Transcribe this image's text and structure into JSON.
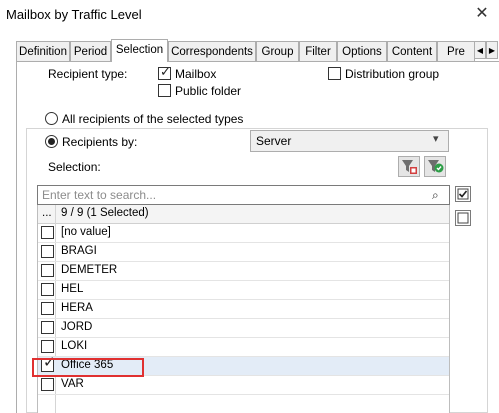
{
  "window": {
    "title": "Mailbox by Traffic Level"
  },
  "tabs": [
    "Definition",
    "Period",
    "Selection",
    "Correspondents",
    "Group",
    "Filter",
    "Options",
    "Content",
    "Pre"
  ],
  "active_tab": "Selection",
  "recipient_type": {
    "label": "Recipient type:",
    "mailbox": {
      "label": "Mailbox",
      "checked": true
    },
    "public_folder": {
      "label": "Public folder",
      "checked": false
    },
    "distribution_group": {
      "label": "Distribution group",
      "checked": false
    }
  },
  "scope": {
    "all_label": "All recipients of the selected types",
    "by_label": "Recipients by:",
    "selected": "by",
    "recipients_by_value": "Server"
  },
  "selection": {
    "label": "Selection:",
    "search_placeholder": "Enter text to search...",
    "header_dots": "...",
    "header_count": "9 / 9 (1 Selected)",
    "rows": [
      {
        "name": "[no value]",
        "checked": false
      },
      {
        "name": "BRAGI",
        "checked": false
      },
      {
        "name": "DEMETER",
        "checked": false
      },
      {
        "name": "HEL",
        "checked": false
      },
      {
        "name": "HERA",
        "checked": false
      },
      {
        "name": "JORD",
        "checked": false
      },
      {
        "name": "LOKI",
        "checked": false
      },
      {
        "name": "Office 365",
        "checked": true
      },
      {
        "name": "VAR",
        "checked": false
      }
    ]
  },
  "icons": {
    "close": "close-icon",
    "clear_filter": "filter-clear-icon",
    "apply_filter": "filter-apply-icon",
    "search": "search-icon",
    "select_all": "check-all-icon",
    "select_none": "uncheck-all-icon"
  },
  "colors": {
    "highlight_border": "#e03030",
    "selected_row": "#e3ecf7"
  }
}
